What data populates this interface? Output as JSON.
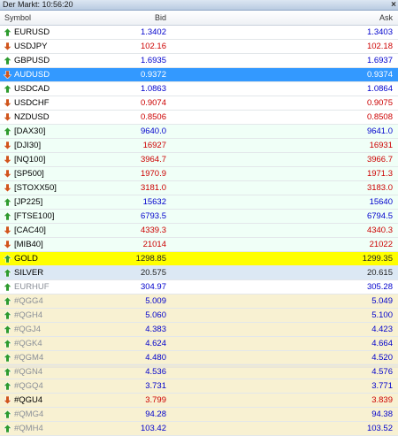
{
  "window": {
    "title": "Der Markt: 10:56:20",
    "close_glyph": "×"
  },
  "columns": {
    "symbol": "Symbol",
    "bid": "Bid",
    "ask": "Ask"
  },
  "rows": [
    {
      "symbol": "EURUSD",
      "bid": "1.3402",
      "ask": "1.3403",
      "dir": "up",
      "style": "fx"
    },
    {
      "symbol": "USDJPY",
      "bid": "102.16",
      "ask": "102.18",
      "dir": "down",
      "style": "fx"
    },
    {
      "symbol": "GBPUSD",
      "bid": "1.6935",
      "ask": "1.6937",
      "dir": "up",
      "style": "fx"
    },
    {
      "symbol": "AUDUSD",
      "bid": "0.9372",
      "ask": "0.9374",
      "dir": "down",
      "style": "selected"
    },
    {
      "symbol": "USDCAD",
      "bid": "1.0863",
      "ask": "1.0864",
      "dir": "up",
      "style": "fx"
    },
    {
      "symbol": "USDCHF",
      "bid": "0.9074",
      "ask": "0.9075",
      "dir": "down",
      "style": "fx"
    },
    {
      "symbol": "NZDUSD",
      "bid": "0.8506",
      "ask": "0.8508",
      "dir": "down",
      "style": "fx"
    },
    {
      "symbol": "[DAX30]",
      "bid": "9640.0",
      "ask": "9641.0",
      "dir": "up",
      "style": "idx"
    },
    {
      "symbol": "[DJI30]",
      "bid": "16927",
      "ask": "16931",
      "dir": "down",
      "style": "idx"
    },
    {
      "symbol": "[NQ100]",
      "bid": "3964.7",
      "ask": "3966.7",
      "dir": "down",
      "style": "idx"
    },
    {
      "symbol": "[SP500]",
      "bid": "1970.9",
      "ask": "1971.3",
      "dir": "down",
      "style": "idx"
    },
    {
      "symbol": "[STOXX50]",
      "bid": "3181.0",
      "ask": "3183.0",
      "dir": "down",
      "style": "idx"
    },
    {
      "symbol": "[JP225]",
      "bid": "15632",
      "ask": "15640",
      "dir": "up",
      "style": "idx"
    },
    {
      "symbol": "[FTSE100]",
      "bid": "6793.5",
      "ask": "6794.5",
      "dir": "up",
      "style": "idx"
    },
    {
      "symbol": "[CAC40]",
      "bid": "4339.3",
      "ask": "4340.3",
      "dir": "down",
      "style": "idx"
    },
    {
      "symbol": "[MIB40]",
      "bid": "21014",
      "ask": "21022",
      "dir": "down",
      "style": "idx"
    },
    {
      "symbol": "GOLD",
      "bid": "1298.85",
      "ask": "1299.35",
      "dir": "up",
      "style": "gold"
    },
    {
      "symbol": "SILVER",
      "bid": "20.575",
      "ask": "20.615",
      "dir": "up",
      "style": "silver"
    },
    {
      "symbol": "EURHUF",
      "bid": "304.97",
      "ask": "305.28",
      "dir": "up",
      "style": "fx",
      "dim": true
    },
    {
      "symbol": "#QGG4",
      "bid": "5.009",
      "ask": "5.049",
      "dir": "up",
      "style": "fut",
      "dim": true
    },
    {
      "symbol": "#QGH4",
      "bid": "5.060",
      "ask": "5.100",
      "dir": "up",
      "style": "fut",
      "dim": true
    },
    {
      "symbol": "#QGJ4",
      "bid": "4.383",
      "ask": "4.423",
      "dir": "up",
      "style": "fut",
      "dim": true
    },
    {
      "symbol": "#QGK4",
      "bid": "4.624",
      "ask": "4.664",
      "dir": "up",
      "style": "fut",
      "dim": true
    },
    {
      "symbol": "#QGM4",
      "bid": "4.480",
      "ask": "4.520",
      "dir": "up",
      "style": "fut",
      "dim": true
    },
    {
      "symbol": "#QGN4",
      "bid": "4.536",
      "ask": "4.576",
      "dir": "up",
      "style": "fut",
      "dim": true
    },
    {
      "symbol": "#QGQ4",
      "bid": "3.731",
      "ask": "3.771",
      "dir": "up",
      "style": "fut",
      "dim": true
    },
    {
      "symbol": "#QGU4",
      "bid": "3.799",
      "ask": "3.839",
      "dir": "down",
      "style": "fut"
    },
    {
      "symbol": "#QMG4",
      "bid": "94.28",
      "ask": "94.38",
      "dir": "up",
      "style": "fut",
      "dim": true
    },
    {
      "symbol": "#QMH4",
      "bid": "103.42",
      "ask": "103.52",
      "dir": "up",
      "style": "fut",
      "dim": true
    }
  ],
  "colors": {
    "up": "#0000cc",
    "down": "#cc0000",
    "selected": "#3399ff",
    "gold_row": "#ffff00",
    "up_arrow": "#2e9b2e",
    "down_arrow": "#d0551c"
  }
}
